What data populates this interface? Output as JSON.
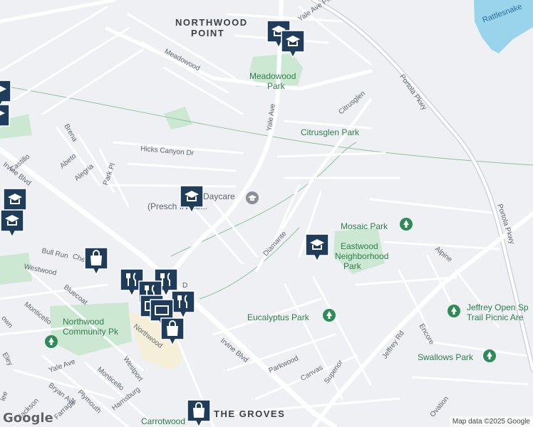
{
  "map": {
    "areas": [
      {
        "id": "northwood-point-1",
        "text": "NORTHWOOD"
      },
      {
        "id": "northwood-point-2",
        "text": "POINT"
      },
      {
        "id": "the-groves",
        "text": "THE GROVES"
      }
    ],
    "parks": [
      {
        "id": "meadowood-park-1",
        "text": "Meadowood"
      },
      {
        "id": "meadowood-park-2",
        "text": "Park"
      },
      {
        "id": "citrusglen-park",
        "text": "Citrusglen Park"
      },
      {
        "id": "mosaic-park",
        "text": "Mosaic Park"
      },
      {
        "id": "eastwood-park-1",
        "text": "Eastwood"
      },
      {
        "id": "eastwood-park-2",
        "text": "Neighborhood"
      },
      {
        "id": "eastwood-park-3",
        "text": "Park"
      },
      {
        "id": "eucalyptus-park",
        "text": "Eucalyptus Park"
      },
      {
        "id": "jeffrey-open-space-1",
        "text": "Jeffrey Open Sp"
      },
      {
        "id": "jeffrey-open-space-2",
        "text": "Trail Picnic Are"
      },
      {
        "id": "swallows-park",
        "text": "Swallows Park"
      },
      {
        "id": "northwood-community-1",
        "text": "Northwood"
      },
      {
        "id": "northwood-community-2",
        "text": "Community Pk"
      },
      {
        "id": "carrotwood-park",
        "text": "Carrotwood"
      },
      {
        "id": "rattlesnake",
        "text": "Rattlesnake"
      }
    ],
    "pois": [
      {
        "id": "daycare-1",
        "text": "Daycare"
      },
      {
        "id": "daycare-2",
        "text": "(Presch    Irvine..."
      }
    ],
    "streets": [
      "Yale Ave Pkwy",
      "Meadowood",
      "Yale Ave",
      "Citrusglen",
      "Portola Pkwy",
      "Portola Pkwy",
      "Hicks Canyon Dr",
      "Brena",
      "Castillo",
      "Abeto",
      "Alegria",
      "Park Pl",
      "Irvine Blvd",
      "Diamante",
      "Alpine",
      "Bull Run",
      "Chest",
      "Westwood",
      "Bluecoat",
      "Monticello",
      "Northwood",
      "Westport",
      "Irvine Blvd",
      "Yale Ave",
      "Monticello",
      "Bryan Ave",
      "Plymouth",
      "Harrisburg",
      "Farragut",
      "Jackson",
      "Parkwood",
      "Canvas",
      "Superior",
      "Jeffrey Rd",
      "Encore",
      "Ovation",
      "Eley",
      "lee",
      "own",
      "D"
    ],
    "markers": {
      "school": [
        "school-icon-1",
        "school-icon-2",
        "school-icon-3",
        "school-icon-4",
        "school-icon-5",
        "school-icon-6",
        "school-icon-7"
      ],
      "shopping": [
        "shopping-icon-1",
        "shopping-icon-2",
        "shopping-icon-3"
      ],
      "restaurant": [
        "restaurant-icon-1",
        "restaurant-icon-2",
        "restaurant-icon-3",
        "restaurant-icon-4"
      ]
    },
    "colors": {
      "background": "#eef0f3",
      "road": "#ffffff",
      "major_road": "#d0d4da",
      "park": "#cce8d3",
      "water": "#9ad4ec",
      "pin": "#1f3d5a",
      "park_pin": "#2e8b57"
    }
  },
  "attribution": {
    "logo": "Google",
    "text": "Map data ©2025 Google"
  }
}
